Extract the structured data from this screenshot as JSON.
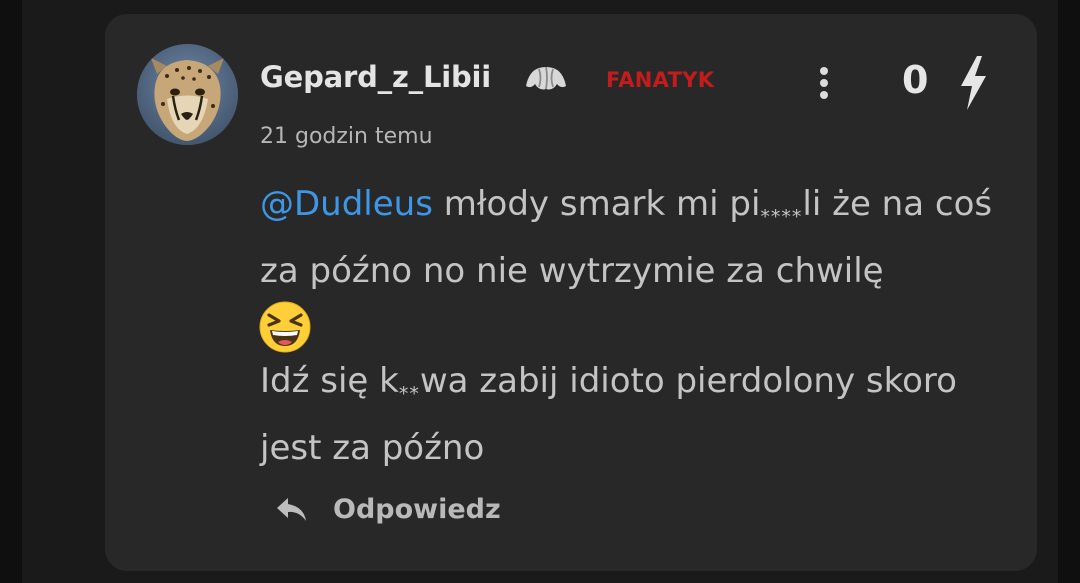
{
  "comment": {
    "author": "Gepard_z_Libii",
    "badge_icon": "croissant-icon",
    "rank": "FANATYK",
    "score": "0",
    "score_icon": "lightning-bolt-icon",
    "menu_icon": "more-vertical-icon",
    "timestamp": "21 godzin temu",
    "mention": "@Dudleus",
    "line1_text": " młody smark mi pi",
    "line1_stars": "****",
    "line1_after": "li że na coś za późno no nie wytrzymie za chwilę",
    "emoji": "grinning-squinting-face",
    "line2_text": "Idź się k",
    "line2_stars": "**",
    "line2_after": "wa zabij idioto pierdolony skoro jest za późno",
    "reply_label": "Odpowiedz",
    "reply_icon": "reply-arrow-icon"
  },
  "colors": {
    "background": "#1a1a1a",
    "card": "#282828",
    "rank": "#c41c1c",
    "mention": "#3d97e6",
    "text": "#c4c4c4"
  }
}
